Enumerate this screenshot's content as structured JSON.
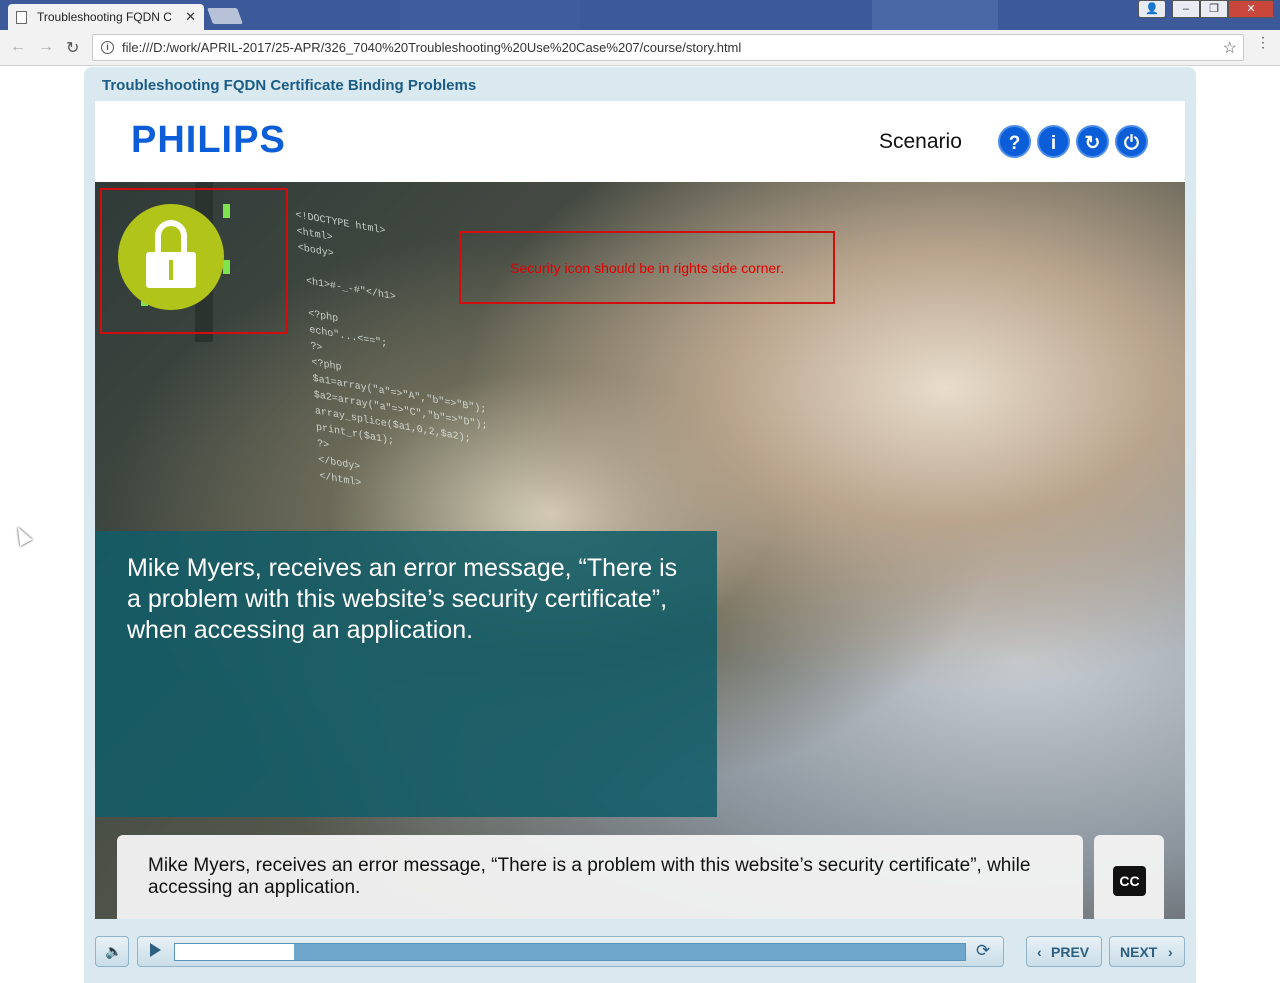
{
  "browser": {
    "tab_title": "Troubleshooting FQDN C",
    "url": "file:///D:/work/APRIL-2017/25-APR/326_7040%20Troubleshooting%20Use%20Case%207/course/story.html"
  },
  "player": {
    "course_title": "Troubleshooting FQDN Certificate Binding Problems",
    "logo_text": "PHILIPS",
    "section_label": "Scenario",
    "header_buttons": [
      {
        "name": "help",
        "glyph": "?"
      },
      {
        "name": "info",
        "glyph": "i"
      },
      {
        "name": "replay",
        "glyph": "↻"
      },
      {
        "name": "exit",
        "glyph": "⏻"
      }
    ]
  },
  "slide": {
    "review_note": "Security icon should be in rights side corner.",
    "main_text": "Mike Myers, receives an error message, “There is a problem with this website’s security certificate”, when accessing an application.",
    "caption": "Mike Myers, receives an error message, “There is a problem with this website’s security certificate”, while accessing an application.",
    "cc_label": "CC",
    "code_lines": "<!DOCTYPE html>\n<html>\n<body>\n\n <h1>#-_-#\"</h1>\n\n <?php\n echo\"...<==\";\n ?>\n <?php\n $a1=array(\"a\"=>\"A\",\"b\"=>\"B\");\n $a2=array(\"a\"=>\"C\",\"b\"=>\"D\");\n array_splice($a1,0,2,$a2);\n print_r($a1);\n ?>\n </body>\n </html>"
  },
  "controls": {
    "volume_icon": "speaker-icon",
    "play_icon": "play-icon",
    "progress": 0.15,
    "prev_label": "PREV",
    "next_label": "NEXT"
  },
  "colors": {
    "brand_blue": "#0b5ed7",
    "lock_green": "#b1c41a",
    "annotation_red": "#d10d0d",
    "teal_panel": "#125c68"
  }
}
